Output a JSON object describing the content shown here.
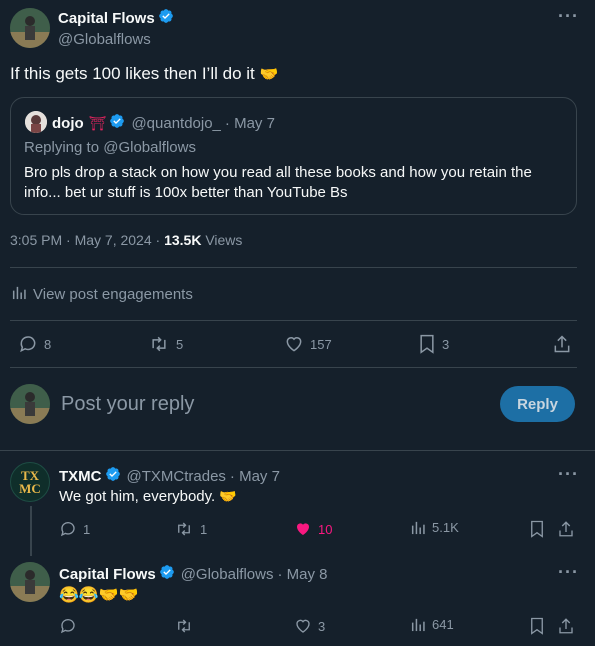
{
  "main_post": {
    "author_name": "Capital Flows",
    "author_handle": "@Globalflows",
    "text": "If this gets 100 likes then I’ll do it",
    "emoji": "🤝",
    "quote": {
      "author_name": "dojo",
      "author_badge": "⛩",
      "author_handle": "@quantdojo_",
      "date": "· May 7",
      "replying_to": "Replying to @Globalflows",
      "text_line1": "Bro pls drop a stack on how you read all these books and how you retain the",
      "text_line2": "info... bet ur stuff is 100x better than YouTube Bs"
    },
    "timestamp": "3:05 PM · May 7, 2024 ·",
    "views_count": "13.5K",
    "views_label": "Views",
    "engagements_label": "View post engagements",
    "stats": {
      "replies": "8",
      "reposts": "5",
      "likes": "157",
      "bookmarks": "3"
    }
  },
  "compose": {
    "placeholder": "Post your reply",
    "reply_button": "Reply"
  },
  "replies": [
    {
      "author_name": "TXMC",
      "author_handle": "@TXMCtrades",
      "date": "· May 7",
      "text": "We got him, everybody.",
      "emoji": "🤝",
      "avatar_text": "TX\nMC",
      "stats": {
        "replies": "1",
        "reposts": "1",
        "likes": "10",
        "views": "5.1K"
      }
    },
    {
      "author_name": "Capital Flows",
      "author_handle": "@Globalflows",
      "date": "· May 8",
      "emojis": "😂😂🤝🤝",
      "stats": {
        "replies": "",
        "reposts": "",
        "likes": "3",
        "views": "641"
      }
    }
  ],
  "colors": {
    "background": "#15202b",
    "text": "#f7f9f9",
    "muted": "#8b98a5",
    "verified": "#1d9bf0",
    "like_active": "#f91880",
    "reply_button": "#1d6fa5",
    "divider": "#38444d"
  }
}
